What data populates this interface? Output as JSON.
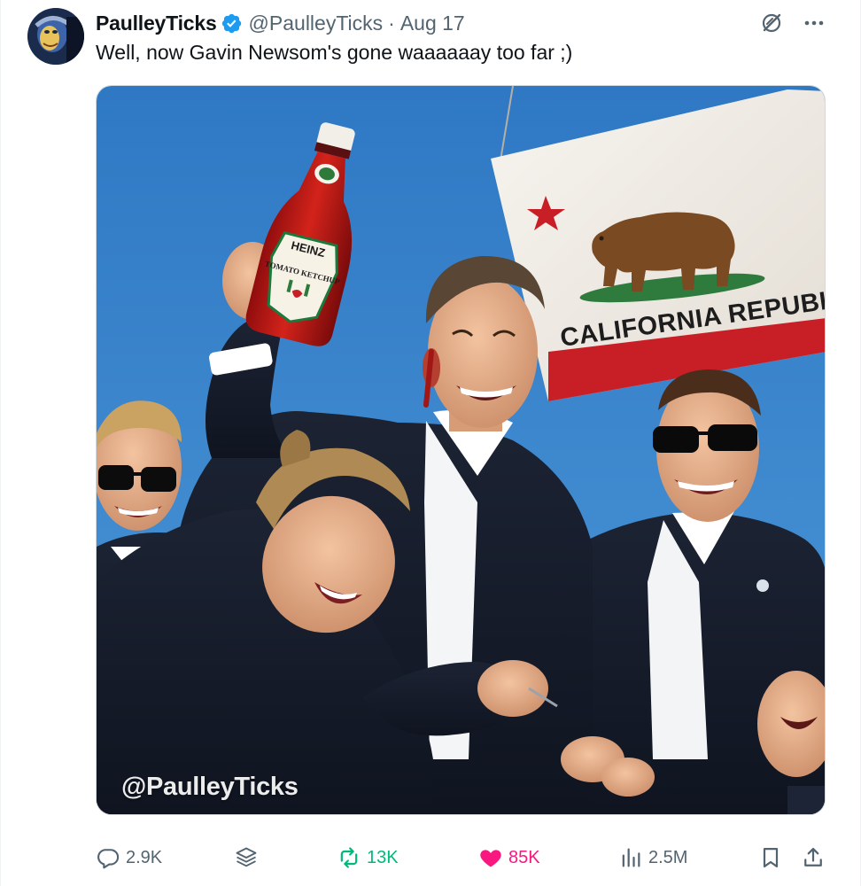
{
  "tweet": {
    "display_name": "PaulleyTicks",
    "handle": "@PaulleyTicks",
    "separator": "·",
    "date": "Aug 17",
    "text": "Well, now Gavin Newsom's gone waaaaaay too far ;)",
    "verified": true
  },
  "media": {
    "watermark": "@PaulleyTicks",
    "bottle_label_brand": "HEINZ",
    "bottle_label_sub": "TOMATO KETCHUP",
    "flag_text": "CALIFORNIA REPUBLIC"
  },
  "actions": {
    "replies": "2.9K",
    "retweets": "13K",
    "likes": "85K",
    "views": "2.5M"
  },
  "icons": {
    "reply": "reply-icon",
    "grok": "grok-icon",
    "retweet": "retweet-icon",
    "like": "heart-icon",
    "views": "views-icon",
    "bookmark": "bookmark-icon",
    "share": "share-icon",
    "more": "more-icon",
    "verified": "verified-badge-icon"
  },
  "colors": {
    "verified": "#1d9bf0",
    "retweet_active": "#00ba7c",
    "like_active": "#f91880",
    "muted": "#536471",
    "text": "#0f1419"
  }
}
